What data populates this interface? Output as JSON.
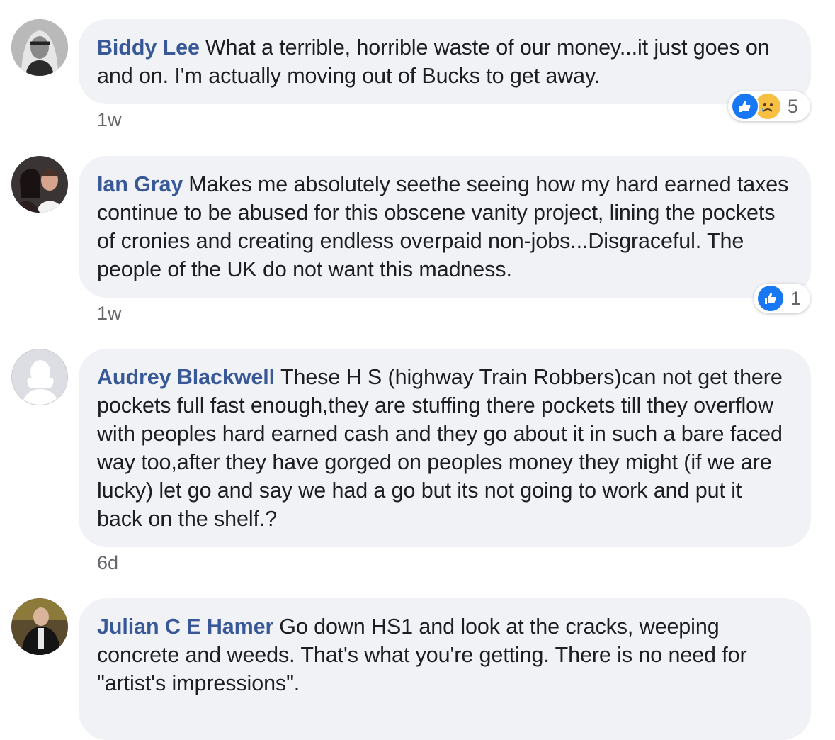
{
  "comments": [
    {
      "author": "Biddy Lee",
      "text": "What a terrible, horrible waste of our money...it just goes on and on. I'm actually moving out of Bucks to get away.",
      "time": "1w",
      "reactions": {
        "types": [
          "like",
          "sad"
        ],
        "count": "5"
      },
      "avatar_icon": "profile-photo"
    },
    {
      "author": "Ian Gray",
      "text": "Makes me absolutely seethe seeing how my hard earned taxes continue to be abused for this obscene vanity project, lining the pockets of cronies and creating endless overpaid non-jobs...Disgraceful. The people of the UK do not want this madness.",
      "time": "1w",
      "reactions": {
        "types": [
          "like"
        ],
        "count": "1"
      },
      "avatar_icon": "profile-photo"
    },
    {
      "author": "Audrey Blackwell",
      "text": "These H S (highway Train Robbers)can not get there pockets full fast enough,they are stuffing there pockets till they overflow with peoples hard earned cash and they go about it in such a bare faced way too,after they have gorged on peoples money they might (if we are lucky) let go and say we had a go but its not going to work and put it back on the shelf.?",
      "time": "6d",
      "avatar_icon": "default-avatar-icon"
    },
    {
      "author": "Julian C E Hamer",
      "text": "Go down HS1 and look at the cracks, weeping concrete and weeds. That's what you're getting. There is no need for \"artist's impressions\".",
      "avatar_icon": "profile-photo"
    }
  ],
  "colors": {
    "author": "#385898",
    "bubble": "#f0f2f5",
    "like": "#1877f2",
    "sad": "#f7c043"
  }
}
